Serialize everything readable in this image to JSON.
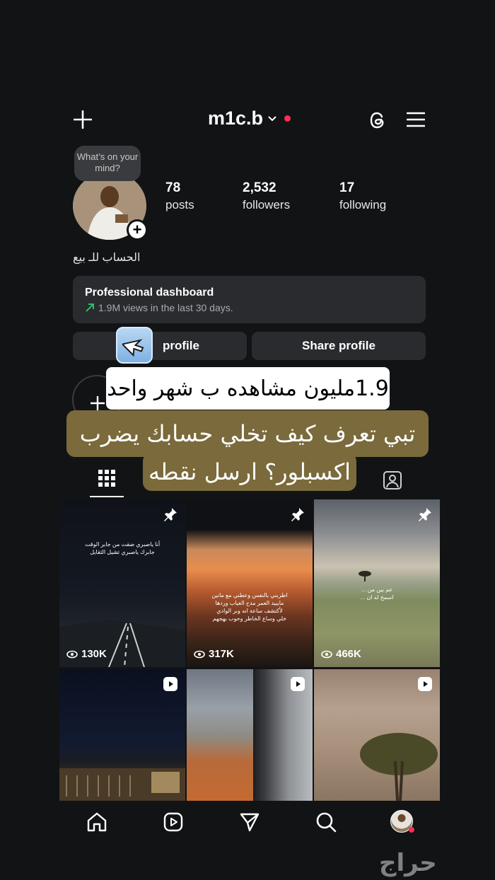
{
  "header": {
    "username": "m1c.b",
    "add_icon": "plus-icon",
    "threads_icon": "threads-icon",
    "menu_icon": "hamburger-icon",
    "notification_dot_color": "#ff2d55"
  },
  "profile": {
    "thought_bubble": "What’s on your mind?",
    "bio": "الحساب للـ بيع",
    "stats": [
      {
        "value": "78",
        "label": "posts"
      },
      {
        "value": "2,532",
        "label": "followers"
      },
      {
        "value": "17",
        "label": "following"
      }
    ]
  },
  "dashboard": {
    "title": "Professional dashboard",
    "subtitle": "1.9M views in the last 30 days.",
    "trend_color": "#2ecc71"
  },
  "buttons": {
    "edit_profile_visible": "profile",
    "share_profile": "Share profile"
  },
  "captions": {
    "line1": "1.9مليون مشاهده ب شهر واحد",
    "line2": "تبي تعرف كيف تخلي حسابك يضرب",
    "line3": "اكسبلور؟ ارسل نقطه",
    "caption_bg": "#7a6a3c"
  },
  "tabs": [
    {
      "name": "grid",
      "icon": "grid-icon",
      "active": true
    },
    {
      "name": "tagged",
      "icon": "tagged-person-icon",
      "active": false
    }
  ],
  "posts": [
    {
      "type": "pinned",
      "views": "130K",
      "text": "أنا ياصبري ضقت من جابر الوقت\nجابرك ياصبري تشيل الثقايل"
    },
    {
      "type": "pinned",
      "views": "317K",
      "text": "اطربني بالنفس وعطني مع مانين\nمايبيد العمر مدح الغياب وردها\nلأكتشف ساعة انه وبر الوادي\nخلي وساع الخاطر وحوب بهجهم"
    },
    {
      "type": "pinned",
      "views": "466K",
      "text": "عم بين من ...\nاسمح له ان ..."
    },
    {
      "type": "reel",
      "views": "",
      "text": ""
    },
    {
      "type": "reel",
      "views": "",
      "text": ""
    },
    {
      "type": "reel",
      "views": "",
      "text": ""
    }
  ],
  "bottom_nav": [
    "home-icon",
    "reels-icon",
    "direct-icon",
    "search-icon",
    "profile-avatar"
  ],
  "watermark": "حراج"
}
